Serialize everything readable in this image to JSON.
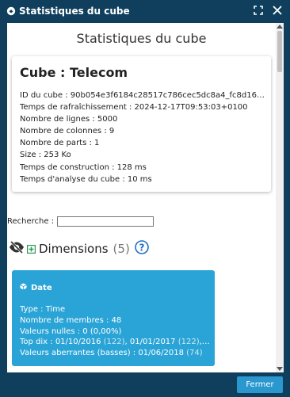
{
  "window": {
    "title": "Statistiques du cube"
  },
  "page": {
    "heading": "Statistiques du cube"
  },
  "cube": {
    "title": "Cube : Telecom",
    "lines": [
      "ID du cube : 90b054e3f6184c28517c786cec5dc8a4_fc8d16a33...",
      "Temps de rafraîchissement : 2024-12-17T09:53:03+0100",
      "Nombre de lignes : 5000",
      "Nombre de colonnes : 9",
      "Nombre de parts : 1",
      "Size : 253 Ko",
      "Temps de construction : 128 ms",
      "Temps d'analyse du cube : 10 ms"
    ]
  },
  "search": {
    "label": "Recherche :",
    "value": "",
    "placeholder": ""
  },
  "dimensions": {
    "title": "Dimensions",
    "count": "(5)"
  },
  "dimension_card": {
    "name": "Date",
    "type": "Type : Time",
    "members": "Nombre de membres : 48",
    "nulls": "Valeurs nulles : 0 (0,00%)",
    "top_prefix": "Top dix : 01/10/2016 ",
    "top_c1": "(122)",
    "top_mid": ", 01/01/2017 ",
    "top_c2": "(122)",
    "top_suffix": ", ...",
    "outliers_prefix": "Valeurs aberrantes (basses) : 01/06/2018 ",
    "outliers_count": "(74)"
  },
  "footer": {
    "close_label": "Fermer"
  },
  "colors": {
    "title_bar": "#0f3f5c",
    "accent": "#2aa4d6",
    "button": "#2a97cf"
  },
  "icons": [
    "cube-logo-icon",
    "fullscreen-icon",
    "close-icon",
    "eye-slash-icon",
    "plus-square-icon",
    "help-circle-icon",
    "cube-icon"
  ]
}
